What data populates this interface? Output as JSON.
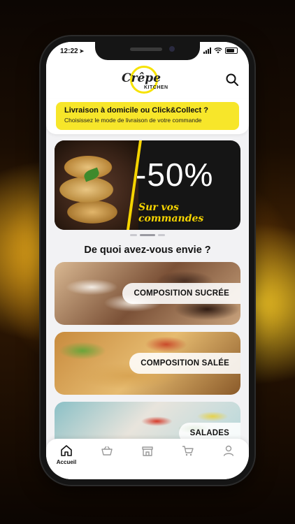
{
  "status_bar": {
    "time": "12:22"
  },
  "brand": {
    "name": "Crêpe",
    "sub": "KITCHEN"
  },
  "delivery": {
    "title": "Livraison à domicile ou Click&Collect ?",
    "subtitle": "Choisissez le mode de livraison de votre commande"
  },
  "banner": {
    "headline": "-50%",
    "subline": "Sur vos commandes"
  },
  "carousel": {
    "count": 3,
    "active_index": 1
  },
  "section_title": "De quoi avez-vous envie ?",
  "categories": [
    {
      "label": "COMPOSITION SUCRÉE"
    },
    {
      "label": "COMPOSITION SALÉE"
    },
    {
      "label": "SALADES"
    }
  ],
  "tabbar": {
    "items": [
      {
        "icon": "home-icon",
        "label": "Accueil",
        "active": true
      },
      {
        "icon": "basket-icon",
        "label": ""
      },
      {
        "icon": "store-icon",
        "label": ""
      },
      {
        "icon": "cart-icon",
        "label": ""
      },
      {
        "icon": "user-icon",
        "label": ""
      }
    ]
  },
  "colors": {
    "accent": "#f7e62a",
    "background": "#f2f2f4"
  }
}
